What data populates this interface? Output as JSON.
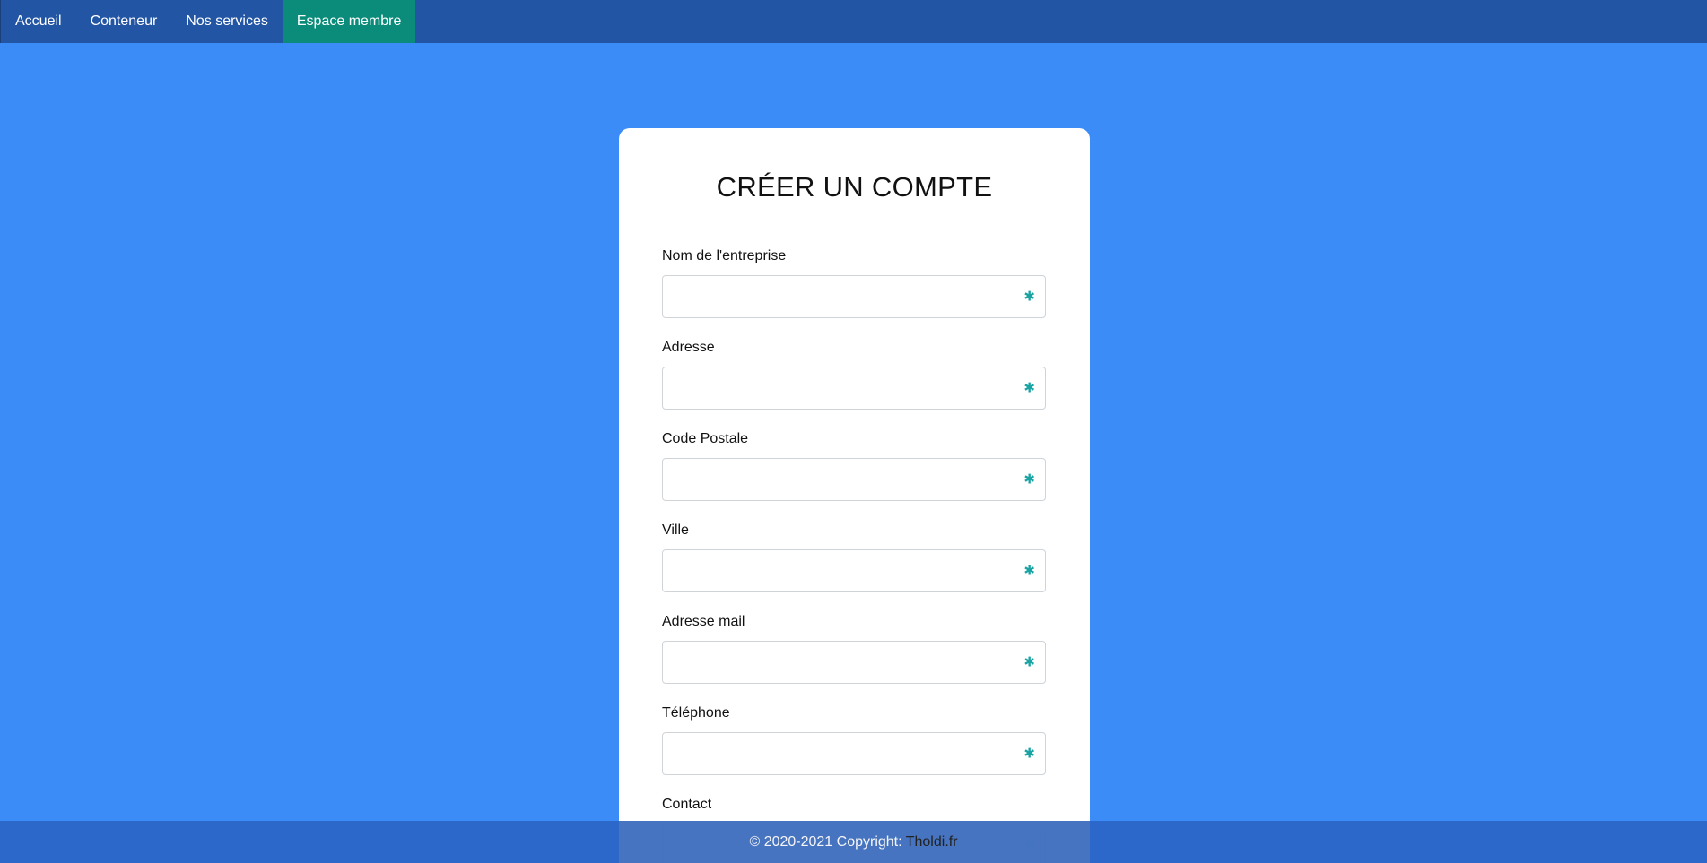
{
  "nav": {
    "items": [
      {
        "label": "Accueil",
        "active": false
      },
      {
        "label": "Conteneur",
        "active": false
      },
      {
        "label": "Nos services",
        "active": false
      },
      {
        "label": "Espace membre",
        "active": true
      }
    ]
  },
  "form": {
    "title": "CRÉER UN COMPTE",
    "required_marker": "✱",
    "fields": [
      {
        "label": "Nom de l'entreprise",
        "value": ""
      },
      {
        "label": "Adresse",
        "value": ""
      },
      {
        "label": "Code Postale",
        "value": ""
      },
      {
        "label": "Ville",
        "value": ""
      },
      {
        "label": "Adresse mail",
        "value": ""
      },
      {
        "label": "Téléphone",
        "value": ""
      },
      {
        "label": "Contact",
        "value": ""
      }
    ]
  },
  "footer": {
    "copyright": "© 2020-2021 Copyright:",
    "link": "Tholdi.fr"
  },
  "colors": {
    "background": "#3c8cf7",
    "navbar": "#2255a4",
    "nav_active": "#0b8b7a",
    "required_icon": "#19a3a3"
  }
}
